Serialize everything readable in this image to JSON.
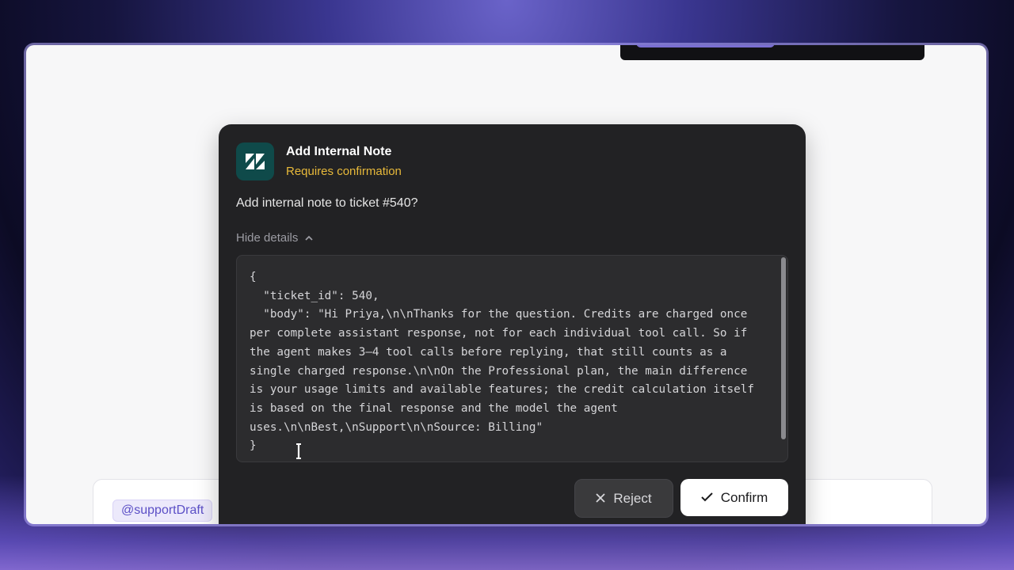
{
  "dialog": {
    "app_icon": "zendesk-icon",
    "title": "Add Internal Note",
    "subtitle": "Requires confirmation",
    "question": "Add internal note to ticket #540?",
    "toggle_label": "Hide details",
    "toggle_icon": "chevron-up-icon",
    "code": "{\n  \"ticket_id\": 540,\n  \"body\": \"Hi Priya,\\n\\nThanks for the question. Credits are charged once per complete assistant response, not for each individual tool call. So if the agent makes 3–4 tool calls before replying, that still counts as a single charged response.\\n\\nOn the Professional plan, the main difference is your usage limits and available features; the credit calculation itself is based on the final response and the model the agent uses.\\n\\nBest,\\nSupport\\n\\nSource: Billing\"\n}",
    "reject_label": "Reject",
    "confirm_label": "Confirm"
  },
  "composer": {
    "mention": "@supportDraft"
  },
  "colors": {
    "dialog_bg": "#222224",
    "subtitle": "#e8b93a",
    "icon_bg": "#0f4a4a"
  }
}
